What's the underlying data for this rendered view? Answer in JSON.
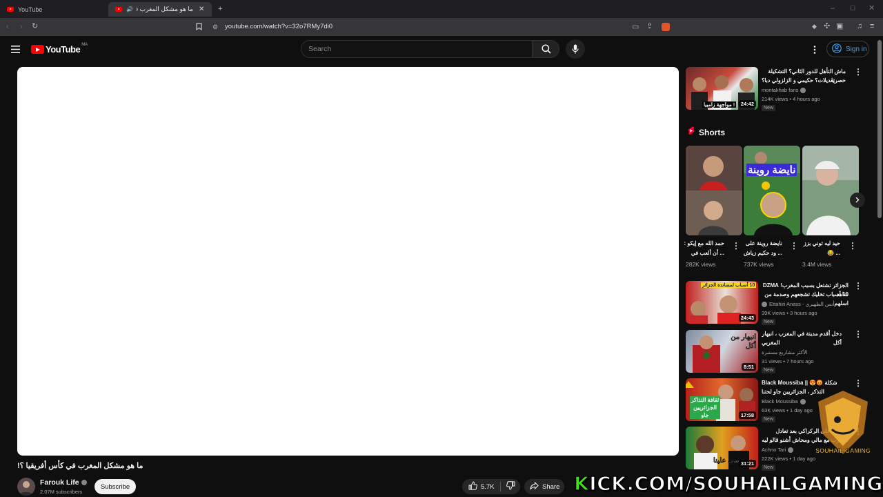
{
  "browser": {
    "tabs": [
      {
        "label": "YouTube"
      },
      {
        "label": "ما هو مشكل المغرب في كأس"
      }
    ],
    "url": "youtube.com/watch?v=32o7RMy7di0"
  },
  "header": {
    "logo_text": "YouTube",
    "country_code": "MA",
    "search_placeholder": "Search",
    "signin_label": "Sign in"
  },
  "video": {
    "title": "ما هو مشكل المغرب في كأس أفريقيا ؟!",
    "channel": "Farouk Life",
    "subscribers": "2.07M subscribers",
    "subscribe_label": "Subscribe",
    "likes": "5.7K",
    "share_label": "Share"
  },
  "sidebar": {
    "top_video": {
      "title_line1": "ماش التأهل للدور الثاني؟ التشكيلة حصريا",
      "title_line2": "تعديلات؟ حكيمي و الزلزولي دبا؟",
      "channel": "montakhab fans",
      "meta": "214K views • 4 hours ago",
      "badge": "New",
      "duration": "24:42",
      "thumb_caption": "مواجهة زامبيا !"
    },
    "shorts_heading": "Shorts",
    "shorts": [
      {
        "title_line1": "حمد الله مع إيكو :",
        "title_line2": "... أن ألعب في",
        "views": "282K views"
      },
      {
        "title_line1": "نايضة روينة على",
        "title_line2": "... ود حكيم زياش",
        "views": "737K views",
        "overlay": "نايضة روينة"
      },
      {
        "title_line1": "حيد ليه توني بزز",
        "title_line2": "... 😂",
        "views": "3.4M views"
      }
    ],
    "videos": [
      {
        "title_line1": "الجزائر تشتعل بسبب المغرب! DZMA شاهد",
        "title_line2": "10 أسباب تخليك تشجعهم وصدمة من اسلهم",
        "channel": "Ettahiri Anass - أنس الطهيري",
        "meta": "39K views • 3 hours ago",
        "badge": "New",
        "duration": "24:43",
        "thumb_caption": "10 أسباب لمساندة الجزائر"
      },
      {
        "title_line1": "دخل أقدم مدينة في المغرب ، انبهار أكل",
        "title_line2": "المغربي",
        "channel": "الأكثر مشاريع مستبرة",
        "meta": "31 views • 7 hours ago",
        "badge": "New",
        "duration": "8:51",
        "thumb_caption": "انبهار من أكل"
      },
      {
        "title_line1": "Black Moussiba || 😍😡 شكلة",
        "title_line2": "التذكر ، الجزائريين جاو لحتنا",
        "channel": "Black Moussiba",
        "meta": "63K views • 1 day ago",
        "badge": "New",
        "duration": "17:58",
        "thumb_caption": "ثقافة التذاكر الجزائريين جاو"
      },
      {
        "title_line1": "سيطرة على الركراكي بعد تعادل",
        "title_line2": "المغرب مع مالي ومحاش أشنو قالو ليه",
        "channel": "Achno Tari",
        "meta": "222K views • 1 day ago",
        "badge": "New",
        "duration": "31:21",
        "thumb_caption": "شي علينا"
      }
    ]
  },
  "overlay": {
    "kick_k": "K",
    "kick_rest": "ICK.COM/SOUHAILGAMING",
    "logo_text": "SOUHAIL GAMING"
  },
  "colors": {
    "youtube_red": "#ff0000",
    "link_blue": "#3ea6ff",
    "kick_green": "#3fe31a",
    "background": "#0f0f0f"
  },
  "icons": [
    "back-icon",
    "forward-icon",
    "reload-icon",
    "bookmark-icon",
    "site-info-icon",
    "menu-icon",
    "search-icon",
    "mic-icon",
    "more-icon",
    "account-icon",
    "like-icon",
    "dislike-icon",
    "share-icon",
    "shorts-icon",
    "chevron-right-icon"
  ]
}
